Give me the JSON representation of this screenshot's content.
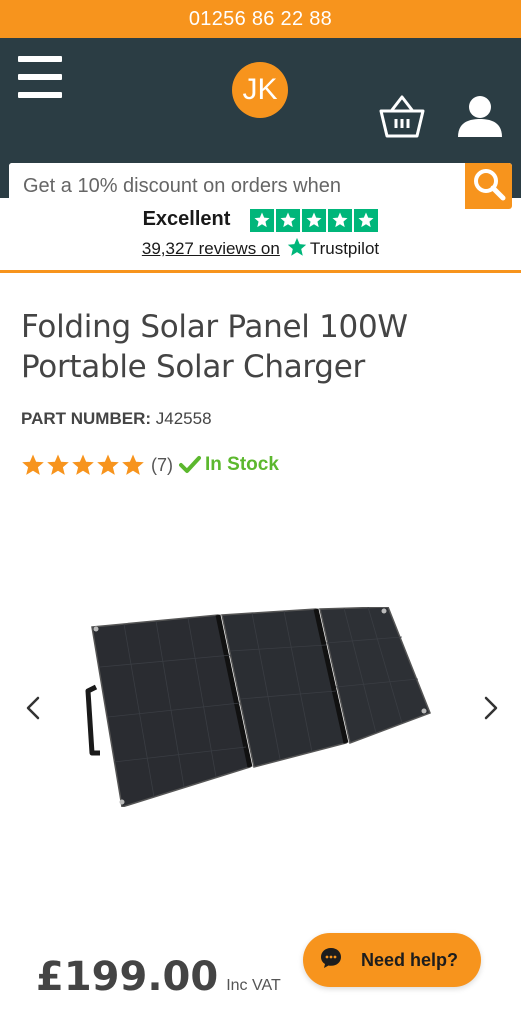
{
  "topbar": {
    "phone": "01256 86 22 88"
  },
  "header": {
    "logo_text": "JK",
    "menu_icon": "hamburger-menu-icon",
    "basket_icon": "basket-icon",
    "account_icon": "user-icon"
  },
  "search": {
    "placeholder": "Get a 10% discount on orders when",
    "button_icon": "search-icon"
  },
  "trustpilot": {
    "rating_word": "Excellent",
    "stars": 5,
    "reviews_link": "39,327 reviews on",
    "brand": "Trustpilot",
    "brand_color": "#00b67a"
  },
  "product": {
    "title_line1": "Folding Solar Panel 100W",
    "title_line2": "Portable Solar Charger",
    "part_label": "PART NUMBER:",
    "part_number": "J42558",
    "rating": 5,
    "review_count": "(7)",
    "stock_status": "In Stock",
    "price": "£199.00",
    "price_suffix": "Inc VAT"
  },
  "gallery": {
    "prev_icon": "chevron-left-icon",
    "next_icon": "chevron-right-icon"
  },
  "help": {
    "label": "Need help?",
    "icon": "chat-bubble-icon"
  },
  "colors": {
    "accent": "#f7941d",
    "header_bg": "#2b3d44",
    "stock_green": "#5cb82e"
  }
}
